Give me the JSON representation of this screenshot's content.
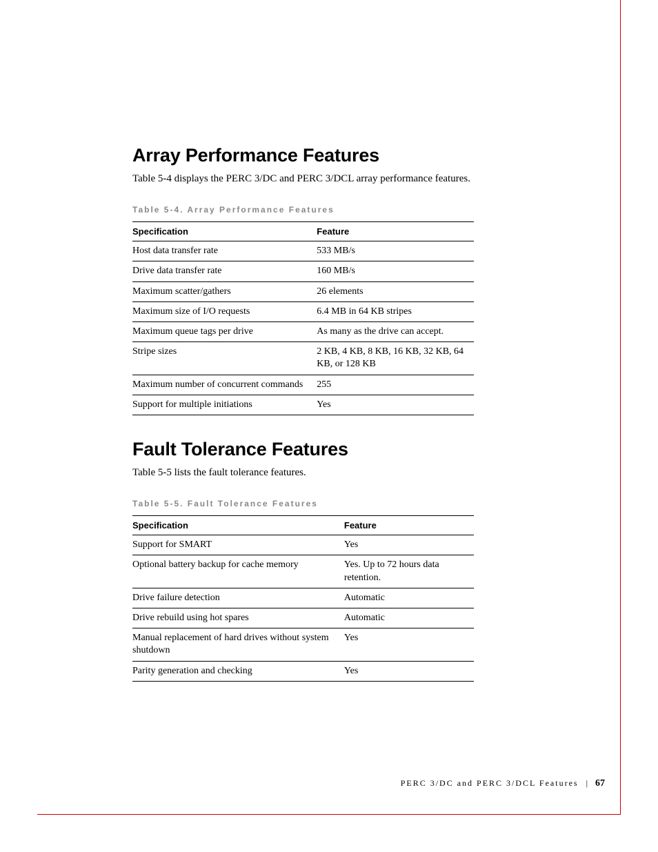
{
  "sections": [
    {
      "heading": "Array Performance Features",
      "intro": "Table 5-4 displays the PERC 3/DC and PERC 3/DCL array performance features.",
      "table_caption": "Table 5-4.  Array Performance Features",
      "col1": "Specification",
      "col2": "Feature",
      "rows": [
        {
          "spec": "Host data transfer rate",
          "feat": "533 MB/s"
        },
        {
          "spec": "Drive data transfer rate",
          "feat": "160 MB/s"
        },
        {
          "spec": "Maximum scatter/gathers",
          "feat": "26 elements"
        },
        {
          "spec": "Maximum size of I/O requests",
          "feat": "6.4 MB in 64 KB stripes"
        },
        {
          "spec": "Maximum queue tags per drive",
          "feat": "As many as the drive can accept."
        },
        {
          "spec": "Stripe sizes",
          "feat": "2 KB, 4 KB, 8 KB, 16 KB, 32 KB, 64 KB, or 128 KB"
        },
        {
          "spec": "Maximum number of concurrent commands",
          "feat": "255"
        },
        {
          "spec": "Support for multiple initiations",
          "feat": "Yes"
        }
      ]
    },
    {
      "heading": "Fault Tolerance Features",
      "intro": "Table 5-5 lists the fault tolerance features.",
      "table_caption": "Table 5-5.  Fault Tolerance Features",
      "col1": "Specification",
      "col2": "Feature",
      "rows": [
        {
          "spec": "Support for SMART",
          "feat": "Yes"
        },
        {
          "spec": "Optional battery backup for cache memory",
          "feat": "Yes. Up to 72 hours data retention."
        },
        {
          "spec": "Drive failure detection",
          "feat": "Automatic"
        },
        {
          "spec": "Drive rebuild using hot spares",
          "feat": "Automatic"
        },
        {
          "spec": "Manual replacement of hard drives without system shutdown",
          "feat": "Yes"
        },
        {
          "spec": "Parity generation and checking",
          "feat": "Yes"
        }
      ]
    }
  ],
  "footer": {
    "title": "PERC 3/DC and PERC 3/DCL Features",
    "sep": "|",
    "page": "67"
  }
}
